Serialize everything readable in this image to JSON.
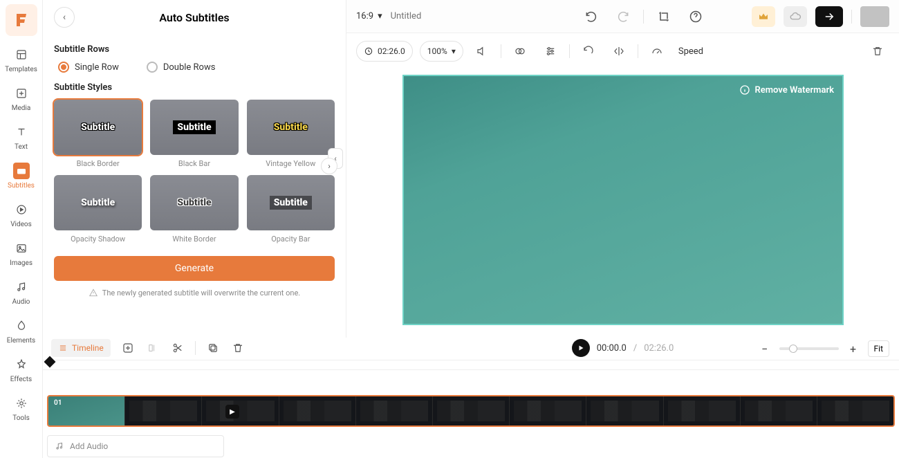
{
  "rail": {
    "items": [
      {
        "label": "Templates"
      },
      {
        "label": "Media"
      },
      {
        "label": "Text"
      },
      {
        "label": "Subtitles"
      },
      {
        "label": "Videos"
      },
      {
        "label": "Images"
      },
      {
        "label": "Audio"
      },
      {
        "label": "Elements"
      },
      {
        "label": "Effects"
      },
      {
        "label": "Tools"
      }
    ]
  },
  "panel": {
    "title": "Auto Subtitles",
    "rows_label": "Subtitle Rows",
    "row_single": "Single Row",
    "row_double": "Double Rows",
    "styles_label": "Subtitle Styles",
    "sample_text": "Subtitle",
    "styles": [
      {
        "cap": "Black Border"
      },
      {
        "cap": "Black Bar"
      },
      {
        "cap": "Vintage Yellow"
      },
      {
        "cap": "Opacity Shadow"
      },
      {
        "cap": "White Border"
      },
      {
        "cap": "Opacity Bar"
      }
    ],
    "generate": "Generate",
    "warn": "The newly generated subtitle will overwrite the current one."
  },
  "topbar": {
    "ratio": "16:9",
    "title_placeholder": "Untitled"
  },
  "ptoolbar": {
    "duration": "02:26.0",
    "zoom": "100%",
    "speed": "Speed"
  },
  "canvas": {
    "remove_wm": "Remove Watermark"
  },
  "playbar": {
    "current": "00:00.0",
    "total": "02:26.0"
  },
  "tl": {
    "chip": "Timeline",
    "fit": "Fit",
    "clip_label": "01",
    "add_audio": "Add Audio"
  }
}
